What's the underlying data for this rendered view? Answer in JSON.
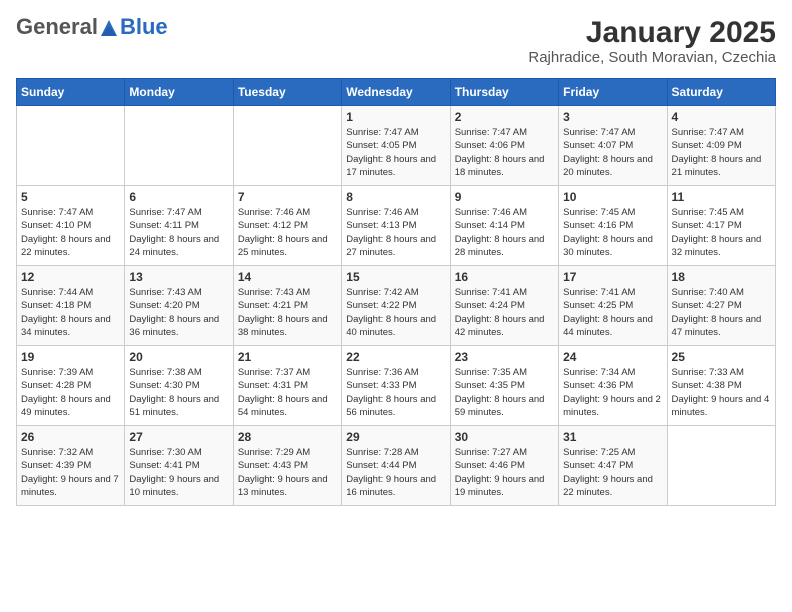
{
  "logo": {
    "general": "General",
    "blue": "Blue",
    "tagline": "Blue"
  },
  "title": "January 2025",
  "subtitle": "Rajhradice, South Moravian, Czechia",
  "days": [
    "Sunday",
    "Monday",
    "Tuesday",
    "Wednesday",
    "Thursday",
    "Friday",
    "Saturday"
  ],
  "weeks": [
    [
      {
        "num": "",
        "text": ""
      },
      {
        "num": "",
        "text": ""
      },
      {
        "num": "",
        "text": ""
      },
      {
        "num": "1",
        "text": "Sunrise: 7:47 AM\nSunset: 4:05 PM\nDaylight: 8 hours\nand 17 minutes."
      },
      {
        "num": "2",
        "text": "Sunrise: 7:47 AM\nSunset: 4:06 PM\nDaylight: 8 hours\nand 18 minutes."
      },
      {
        "num": "3",
        "text": "Sunrise: 7:47 AM\nSunset: 4:07 PM\nDaylight: 8 hours\nand 20 minutes."
      },
      {
        "num": "4",
        "text": "Sunrise: 7:47 AM\nSunset: 4:09 PM\nDaylight: 8 hours\nand 21 minutes."
      }
    ],
    [
      {
        "num": "5",
        "text": "Sunrise: 7:47 AM\nSunset: 4:10 PM\nDaylight: 8 hours\nand 22 minutes."
      },
      {
        "num": "6",
        "text": "Sunrise: 7:47 AM\nSunset: 4:11 PM\nDaylight: 8 hours\nand 24 minutes."
      },
      {
        "num": "7",
        "text": "Sunrise: 7:46 AM\nSunset: 4:12 PM\nDaylight: 8 hours\nand 25 minutes."
      },
      {
        "num": "8",
        "text": "Sunrise: 7:46 AM\nSunset: 4:13 PM\nDaylight: 8 hours\nand 27 minutes."
      },
      {
        "num": "9",
        "text": "Sunrise: 7:46 AM\nSunset: 4:14 PM\nDaylight: 8 hours\nand 28 minutes."
      },
      {
        "num": "10",
        "text": "Sunrise: 7:45 AM\nSunset: 4:16 PM\nDaylight: 8 hours\nand 30 minutes."
      },
      {
        "num": "11",
        "text": "Sunrise: 7:45 AM\nSunset: 4:17 PM\nDaylight: 8 hours\nand 32 minutes."
      }
    ],
    [
      {
        "num": "12",
        "text": "Sunrise: 7:44 AM\nSunset: 4:18 PM\nDaylight: 8 hours\nand 34 minutes."
      },
      {
        "num": "13",
        "text": "Sunrise: 7:43 AM\nSunset: 4:20 PM\nDaylight: 8 hours\nand 36 minutes."
      },
      {
        "num": "14",
        "text": "Sunrise: 7:43 AM\nSunset: 4:21 PM\nDaylight: 8 hours\nand 38 minutes."
      },
      {
        "num": "15",
        "text": "Sunrise: 7:42 AM\nSunset: 4:22 PM\nDaylight: 8 hours\nand 40 minutes."
      },
      {
        "num": "16",
        "text": "Sunrise: 7:41 AM\nSunset: 4:24 PM\nDaylight: 8 hours\nand 42 minutes."
      },
      {
        "num": "17",
        "text": "Sunrise: 7:41 AM\nSunset: 4:25 PM\nDaylight: 8 hours\nand 44 minutes."
      },
      {
        "num": "18",
        "text": "Sunrise: 7:40 AM\nSunset: 4:27 PM\nDaylight: 8 hours\nand 47 minutes."
      }
    ],
    [
      {
        "num": "19",
        "text": "Sunrise: 7:39 AM\nSunset: 4:28 PM\nDaylight: 8 hours\nand 49 minutes."
      },
      {
        "num": "20",
        "text": "Sunrise: 7:38 AM\nSunset: 4:30 PM\nDaylight: 8 hours\nand 51 minutes."
      },
      {
        "num": "21",
        "text": "Sunrise: 7:37 AM\nSunset: 4:31 PM\nDaylight: 8 hours\nand 54 minutes."
      },
      {
        "num": "22",
        "text": "Sunrise: 7:36 AM\nSunset: 4:33 PM\nDaylight: 8 hours\nand 56 minutes."
      },
      {
        "num": "23",
        "text": "Sunrise: 7:35 AM\nSunset: 4:35 PM\nDaylight: 8 hours\nand 59 minutes."
      },
      {
        "num": "24",
        "text": "Sunrise: 7:34 AM\nSunset: 4:36 PM\nDaylight: 9 hours\nand 2 minutes."
      },
      {
        "num": "25",
        "text": "Sunrise: 7:33 AM\nSunset: 4:38 PM\nDaylight: 9 hours\nand 4 minutes."
      }
    ],
    [
      {
        "num": "26",
        "text": "Sunrise: 7:32 AM\nSunset: 4:39 PM\nDaylight: 9 hours\nand 7 minutes."
      },
      {
        "num": "27",
        "text": "Sunrise: 7:30 AM\nSunset: 4:41 PM\nDaylight: 9 hours\nand 10 minutes."
      },
      {
        "num": "28",
        "text": "Sunrise: 7:29 AM\nSunset: 4:43 PM\nDaylight: 9 hours\nand 13 minutes."
      },
      {
        "num": "29",
        "text": "Sunrise: 7:28 AM\nSunset: 4:44 PM\nDaylight: 9 hours\nand 16 minutes."
      },
      {
        "num": "30",
        "text": "Sunrise: 7:27 AM\nSunset: 4:46 PM\nDaylight: 9 hours\nand 19 minutes."
      },
      {
        "num": "31",
        "text": "Sunrise: 7:25 AM\nSunset: 4:47 PM\nDaylight: 9 hours\nand 22 minutes."
      },
      {
        "num": "",
        "text": ""
      }
    ]
  ]
}
